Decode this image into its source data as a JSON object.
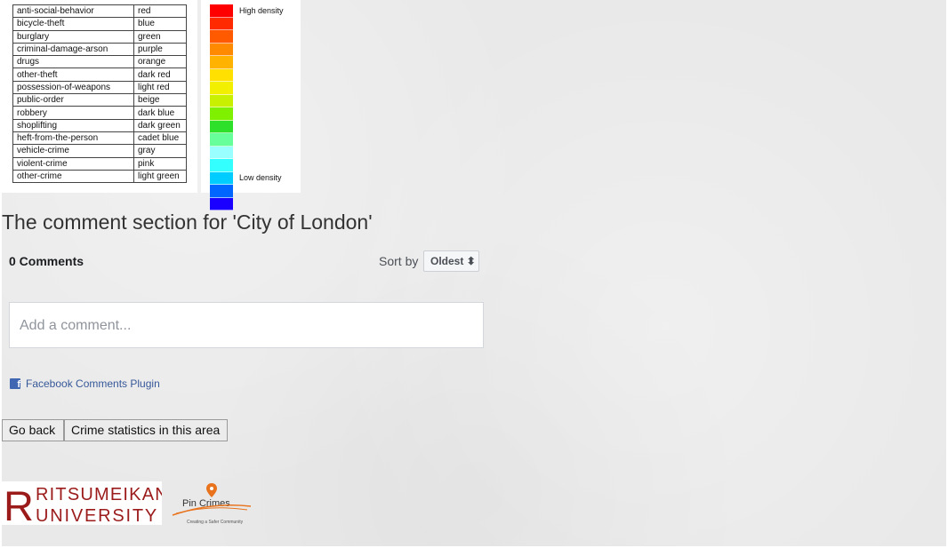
{
  "legend": {
    "rows": [
      {
        "crime": "anti-social-behavior",
        "color": "red"
      },
      {
        "crime": "bicycle-theft",
        "color": "blue"
      },
      {
        "crime": "burglary",
        "color": "green"
      },
      {
        "crime": "criminal-damage-arson",
        "color": "purple"
      },
      {
        "crime": "drugs",
        "color": "orange"
      },
      {
        "crime": "other-theft",
        "color": "dark red"
      },
      {
        "crime": "possession-of-weapons",
        "color": "light red"
      },
      {
        "crime": "public-order",
        "color": "beige"
      },
      {
        "crime": "robbery",
        "color": "dark blue"
      },
      {
        "crime": "shoplifting",
        "color": "dark green"
      },
      {
        "crime": "heft-from-the-person",
        "color": "cadet blue"
      },
      {
        "crime": "vehicle-crime",
        "color": "gray"
      },
      {
        "crime": "violent-crime",
        "color": "pink"
      },
      {
        "crime": "other-crime",
        "color": "light green"
      }
    ]
  },
  "density": {
    "high_label": "High density",
    "low_label": "Low density",
    "colors": [
      "#ff0000",
      "#ff2a00",
      "#ff5a00",
      "#ff8a00",
      "#ffb300",
      "#ffe000",
      "#f2f000",
      "#c8f000",
      "#7ef000",
      "#2ee02a",
      "#66ff99",
      "#99ffff",
      "#33ffff",
      "#00ccff",
      "#0066ff",
      "#1a00ff"
    ]
  },
  "comments": {
    "title": "The comment section for 'City of London'",
    "count_label": "0 Comments",
    "sort_label": "Sort by",
    "sort_value": "Oldest ⬍",
    "placeholder": "Add a comment...",
    "plugin_label": "Facebook Comments Plugin"
  },
  "buttons": {
    "go_back": "Go back",
    "crime_stats": "Crime statistics in this area"
  },
  "logos": {
    "ritsumeikan_line1": "RITSUMEIKAN",
    "ritsumeikan_line2": "UNIVERSITY",
    "ritsumeikan_letter": "R",
    "pincrimes_name": "Pin Crimes",
    "pincrimes_tagline": "Creating a Safer Community"
  },
  "colors": {
    "ritsumeikan_red": "#9b1b1b",
    "pin_orange": "#e8731c"
  }
}
